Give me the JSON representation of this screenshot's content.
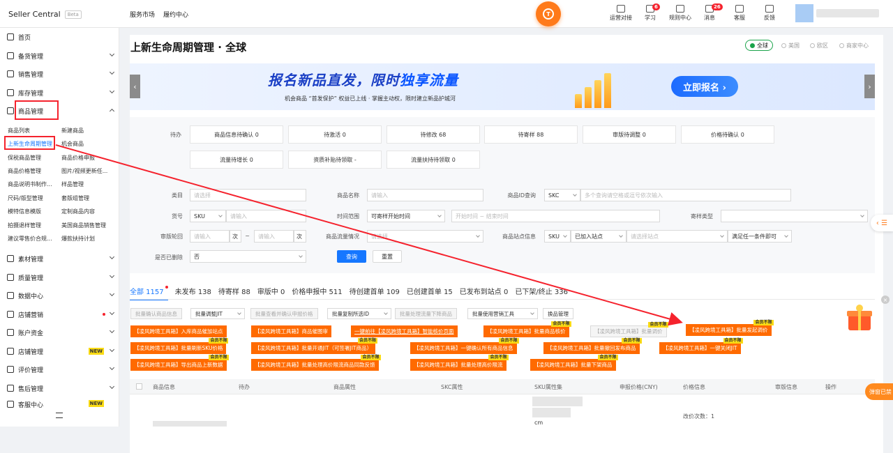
{
  "app": {
    "name": "Seller Central",
    "beta": "Beta"
  },
  "topnav": [
    "服务市场",
    "履约中心"
  ],
  "center_badge": "T",
  "tools": [
    {
      "label": "运营对接",
      "icon": "chat-icon"
    },
    {
      "label": "学习",
      "icon": "book-icon",
      "badge": "6"
    },
    {
      "label": "规则中心",
      "icon": "document-icon"
    },
    {
      "label": "消息",
      "icon": "bell-icon",
      "badge": "26"
    },
    {
      "label": "客服",
      "icon": "headset-icon"
    },
    {
      "label": "反馈",
      "icon": "feedback-icon"
    }
  ],
  "sidebar": {
    "items": [
      {
        "label": "首页",
        "icon": "home-icon"
      },
      {
        "label": "备货管理",
        "icon": "clipboard-icon"
      },
      {
        "label": "销售管理",
        "icon": "chart-icon"
      },
      {
        "label": "库存管理",
        "icon": "inventory-icon"
      },
      {
        "label": "商品管理",
        "icon": "box-icon"
      }
    ],
    "sub": [
      [
        "商品列表",
        "新建商品"
      ],
      [
        "上新生命周期管理",
        "机会商品"
      ],
      [
        "保税商品管理",
        "商品价格申报"
      ],
      [
        "商品价格管理",
        "图片/视频更新任..."
      ],
      [
        "商品说明书制作...",
        "样品管理"
      ],
      [
        "尺码/版型管理",
        "套版组管理"
      ],
      [
        "模特信息模版",
        "定制商品内容"
      ],
      [
        "拍摄退样管理",
        "美国商品销售管理"
      ],
      [
        "建议零售价合规...",
        "爆款扶持计划"
      ]
    ],
    "items2": [
      {
        "label": "素材管理",
        "icon": "material-icon"
      },
      {
        "label": "质量管理",
        "icon": "quality-icon"
      },
      {
        "label": "数据中心",
        "icon": "data-icon"
      },
      {
        "label": "店铺营销",
        "icon": "marketing-icon",
        "dot": true
      },
      {
        "label": "账户资金",
        "icon": "wallet-icon"
      },
      {
        "label": "店铺管理",
        "icon": "store-icon",
        "tag": "NEW"
      },
      {
        "label": "评价管理",
        "icon": "review-icon"
      },
      {
        "label": "售后管理",
        "icon": "aftersale-icon"
      },
      {
        "label": "客服中心",
        "icon": "service-icon",
        "tag": "NEW"
      }
    ]
  },
  "page": {
    "title": "上新生命周期管理 · 全球"
  },
  "regions": [
    "全球",
    "美国",
    "欧区",
    "商家中心"
  ],
  "banner": {
    "title_a": "报名新品直发，限时",
    "title_b": "独享流量",
    "subtitle": "机会商品 “首发保护” 权益已上线 · 掌握主动权，限时建立新品护城河",
    "button": "立即报名 ›"
  },
  "todo": {
    "label": "待办",
    "row1": [
      "商品信息待确认 0",
      "待激活 0",
      "待修改 68",
      "待寄样 88",
      "审版待调整 0",
      "价格待确认 0"
    ],
    "row2": [
      "流量待增长 0",
      "资质补贴待领取 -",
      "流量扶持待领取 0"
    ]
  },
  "filters": {
    "category": {
      "label": "类目",
      "placeholder": "请选择"
    },
    "name": {
      "label": "商品名称",
      "placeholder": "请输入"
    },
    "id_query": {
      "label": "商品ID查询",
      "select": "SKC",
      "placeholder": "多个查询请空格或逗号依次输入"
    },
    "code": {
      "label": "货号",
      "select": "SKU",
      "placeholder": "请输入"
    },
    "time": {
      "label": "时间范围",
      "select": "可寄样开始时间",
      "start": "开始时间",
      "sep": "~",
      "end": "结束时间"
    },
    "sample_type": {
      "label": "寄样类型"
    },
    "review_round": {
      "label": "审版轮回",
      "from": "请输入",
      "unit": "次",
      "sep": "~",
      "to": "请输入"
    },
    "traffic": {
      "label": "商品流量情况",
      "placeholder": "请选择"
    },
    "site": {
      "label": "商品站点信息",
      "select": "SKU",
      "joined": "已加入站点",
      "placeholder": "请选择站点",
      "match": "满足任一条件即可"
    },
    "deleted": {
      "label": "是否已删除",
      "value": "否"
    },
    "query": "查询",
    "reset": "重置"
  },
  "tabs": [
    {
      "label": "全部 1157",
      "dot": true
    },
    {
      "label": "未发布 138"
    },
    {
      "label": "待寄样 88"
    },
    {
      "label": "审版中 0"
    },
    {
      "label": "价格申报中 511"
    },
    {
      "label": "待创建首单 109"
    },
    {
      "label": "已创建首单 15"
    },
    {
      "label": "已发布到站点 0"
    },
    {
      "label": "已下架/终止 336"
    }
  ],
  "toolbar": [
    "批量确认商品信息",
    "批量调整JIT",
    "批量查看并确认申报价格",
    "批量复制所选ID",
    "批量处理流量下降商品",
    "批量使用营销工具",
    "换品管理"
  ],
  "vip_tag": "会员不限",
  "plugins": {
    "row1": [
      "【凌风跨境工具箱】入库商品催加站点",
      "【凌风跨境工具箱】商品催图审",
      "一键前往【凌风跨境工具箱】智能核价页面",
      "【凌风跨境工具箱】批量商品核价",
      "【凌风跨境工具箱】批量调价",
      "【凌风跨境工具箱】批量发起调价"
    ],
    "row2": [
      "【凌风跨境工具箱】批量刷新SKU价格",
      "【凌风跨境工具箱】批量开通JIT（可签署JIT商品）",
      "【凌风跨境工具箱】一键确认所有商品信息",
      "【凌风跨境工具箱】批量撤回发布商品",
      "【凌风跨境工具箱】一键关闭JIT"
    ],
    "row3": [
      "【凌风跨境工具箱】导出商品上新数据",
      "【凌风跨境工具箱】批量处理高价限流商品同款反馈",
      "【凌风跨境工具箱】批量处理高价限流",
      "【凌风跨境工具箱】批量下架商品"
    ]
  },
  "table": {
    "headers": [
      "商品信息",
      "待办",
      "商品属性",
      "SKC属性",
      "SKU属性集",
      "申报价格(CNY)",
      "价格信息",
      "审版信息",
      "操作"
    ],
    "row": {
      "sku_text": "cm",
      "price_change": "改价次数：1"
    }
  },
  "floating": {
    "popup": "弹窗已禁",
    "side": "‹ ☰"
  },
  "colors": {
    "primary": "#1677ff",
    "orange": "#ff6a00",
    "red": "#f5222d",
    "green": "#1aa34a"
  }
}
